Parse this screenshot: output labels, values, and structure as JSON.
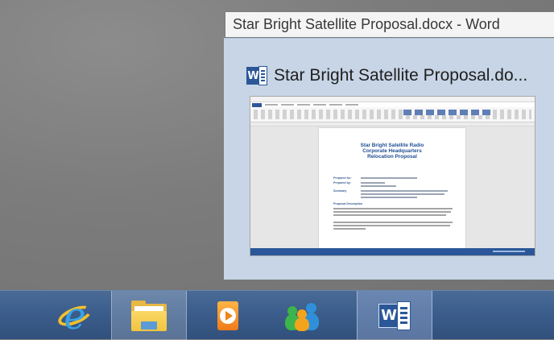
{
  "tooltip": {
    "text": "Star Bright Satellite Proposal.docx - Word"
  },
  "preview": {
    "title": "Star Bright Satellite Proposal.do...",
    "app_icon": "word-icon",
    "document": {
      "heading": "Star Bright Satellite Radio\nCorporate Headquarters\nRelocation Proposal",
      "fields": [
        "Prepared for:",
        "Prepared by:",
        "Summary"
      ],
      "section": "Proposal Description"
    }
  },
  "taskbar": {
    "items": [
      {
        "name": "Internet Explorer",
        "icon": "internet-explorer-icon",
        "active": false
      },
      {
        "name": "File Explorer",
        "icon": "folder-icon",
        "active": true
      },
      {
        "name": "Windows Media Player",
        "icon": "media-player-icon",
        "active": false
      },
      {
        "name": "Windows Live Messenger",
        "icon": "messenger-people-icon",
        "active": false
      },
      {
        "name": "Word",
        "icon": "word-icon",
        "active": false,
        "hover": true
      }
    ]
  },
  "colors": {
    "taskbar": "#3d5f8d",
    "preview_panel": "#c7d5e6",
    "word_blue": "#2b5797",
    "tooltip_bg": "#f4f4f4"
  }
}
